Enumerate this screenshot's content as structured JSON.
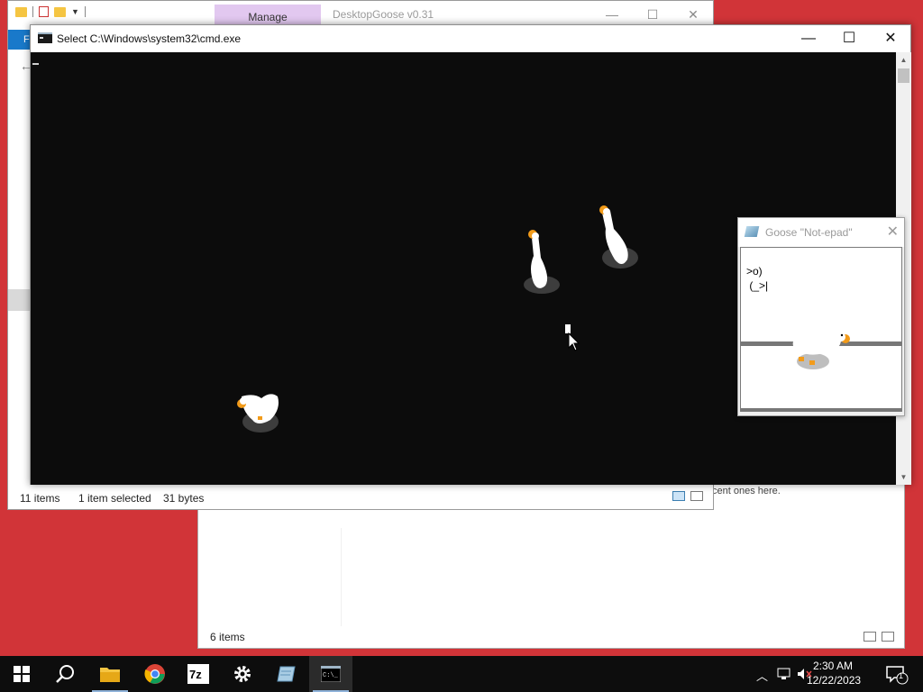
{
  "explorer1": {
    "manage_tab": "Manage",
    "title": "DesktopGoose v0.31",
    "file_tab": "F",
    "status": {
      "items": "11 items",
      "selected": "1 item selected",
      "size": "31 bytes"
    },
    "minimize": "—",
    "maximize": "☐",
    "close": "✕"
  },
  "explorer2": {
    "recent_text": "cent ones here.",
    "status_items": "6 items"
  },
  "cmd": {
    "title": "Select C:\\Windows\\system32\\cmd.exe",
    "minimize": "—",
    "maximize": "☐",
    "close": "✕"
  },
  "notepad": {
    "title": "Goose \"Not-epad\"",
    "close": "✕",
    "line1": ">o)",
    "line2": " (_>|"
  },
  "taskbar": {
    "apps": [
      "start",
      "search",
      "file-explorer",
      "chrome",
      "7-zip",
      "settings",
      "goose-notepad",
      "command-prompt"
    ],
    "time": "2:30 AM",
    "date": "12/22/2023",
    "notifications": "1",
    "colors": {
      "bar": "#0d0d0d",
      "accent": "#8fb2d9"
    }
  },
  "colors": {
    "desktop": "#d13438",
    "console": "#0c0c0c",
    "manage_tab": "#e2c8f0"
  }
}
